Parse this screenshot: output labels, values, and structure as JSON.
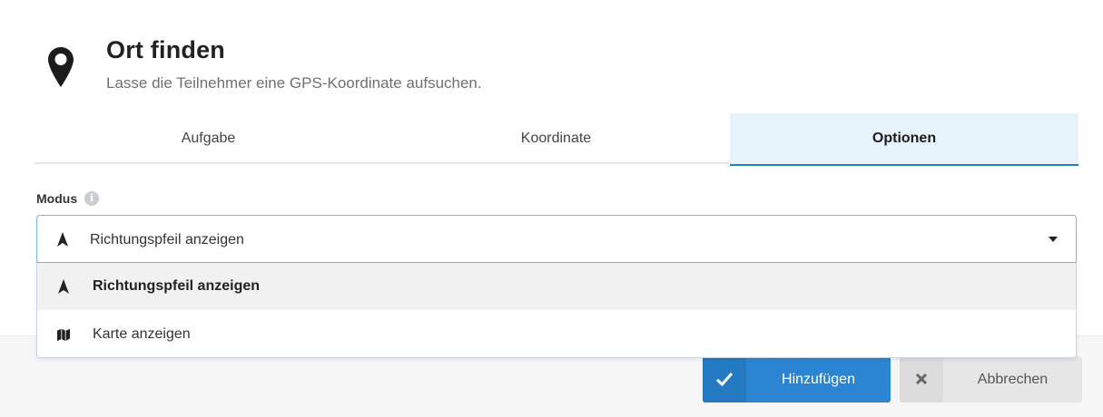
{
  "header": {
    "title": "Ort finden",
    "subtitle": "Lasse die Teilnehmer eine GPS-Koordinate aufsuchen.",
    "icon": "map-pin-icon"
  },
  "tabs": [
    {
      "label": "Aufgabe",
      "active": false
    },
    {
      "label": "Koordinate",
      "active": false
    },
    {
      "label": "Optionen",
      "active": true
    }
  ],
  "modus": {
    "label": "Modus",
    "info_icon": "info-icon",
    "selected": {
      "label": "Richtungspfeil anzeigen",
      "icon": "direction-arrow-icon"
    },
    "options": [
      {
        "label": "Richtungspfeil anzeigen",
        "icon": "direction-arrow-icon",
        "highlighted": true
      },
      {
        "label": "Karte anzeigen",
        "icon": "map-icon",
        "highlighted": false
      }
    ]
  },
  "buttons": {
    "add": {
      "label": "Hinzufügen",
      "icon": "check-icon"
    },
    "cancel": {
      "label": "Abbrechen",
      "icon": "close-icon"
    }
  },
  "colors": {
    "primary": "#2b84d1",
    "active_tab_bg": "#e6f3fa",
    "active_tab_border": "#1f7fc4",
    "cancel_bg": "#e6e6e6"
  }
}
